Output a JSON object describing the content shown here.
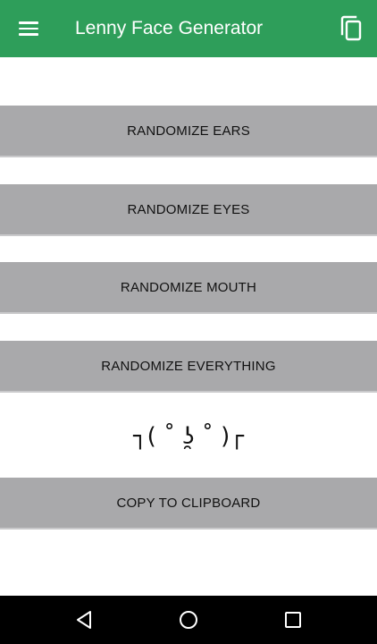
{
  "app_bar": {
    "title": "Lenny Face Generator",
    "background_color": "#2e9e5a",
    "menu_icon": "hamburger-menu-icon",
    "copy_icon": "copy-icon"
  },
  "actions": {
    "randomize_ears": "RANDOMIZE EARS",
    "randomize_eyes": "RANDOMIZE EYES",
    "randomize_mouth": "RANDOMIZE MOUTH",
    "randomize_everything": "RANDOMIZE EVERYTHING",
    "copy_to_clipboard": "COPY TO CLIPBOARD"
  },
  "face": {
    "text": "┐( ˚ ʖ̯ ˚ )┌"
  },
  "nav_bar": {
    "back_icon": "back-triangle-icon",
    "home_icon": "home-circle-icon",
    "recents_icon": "recents-square-icon"
  }
}
